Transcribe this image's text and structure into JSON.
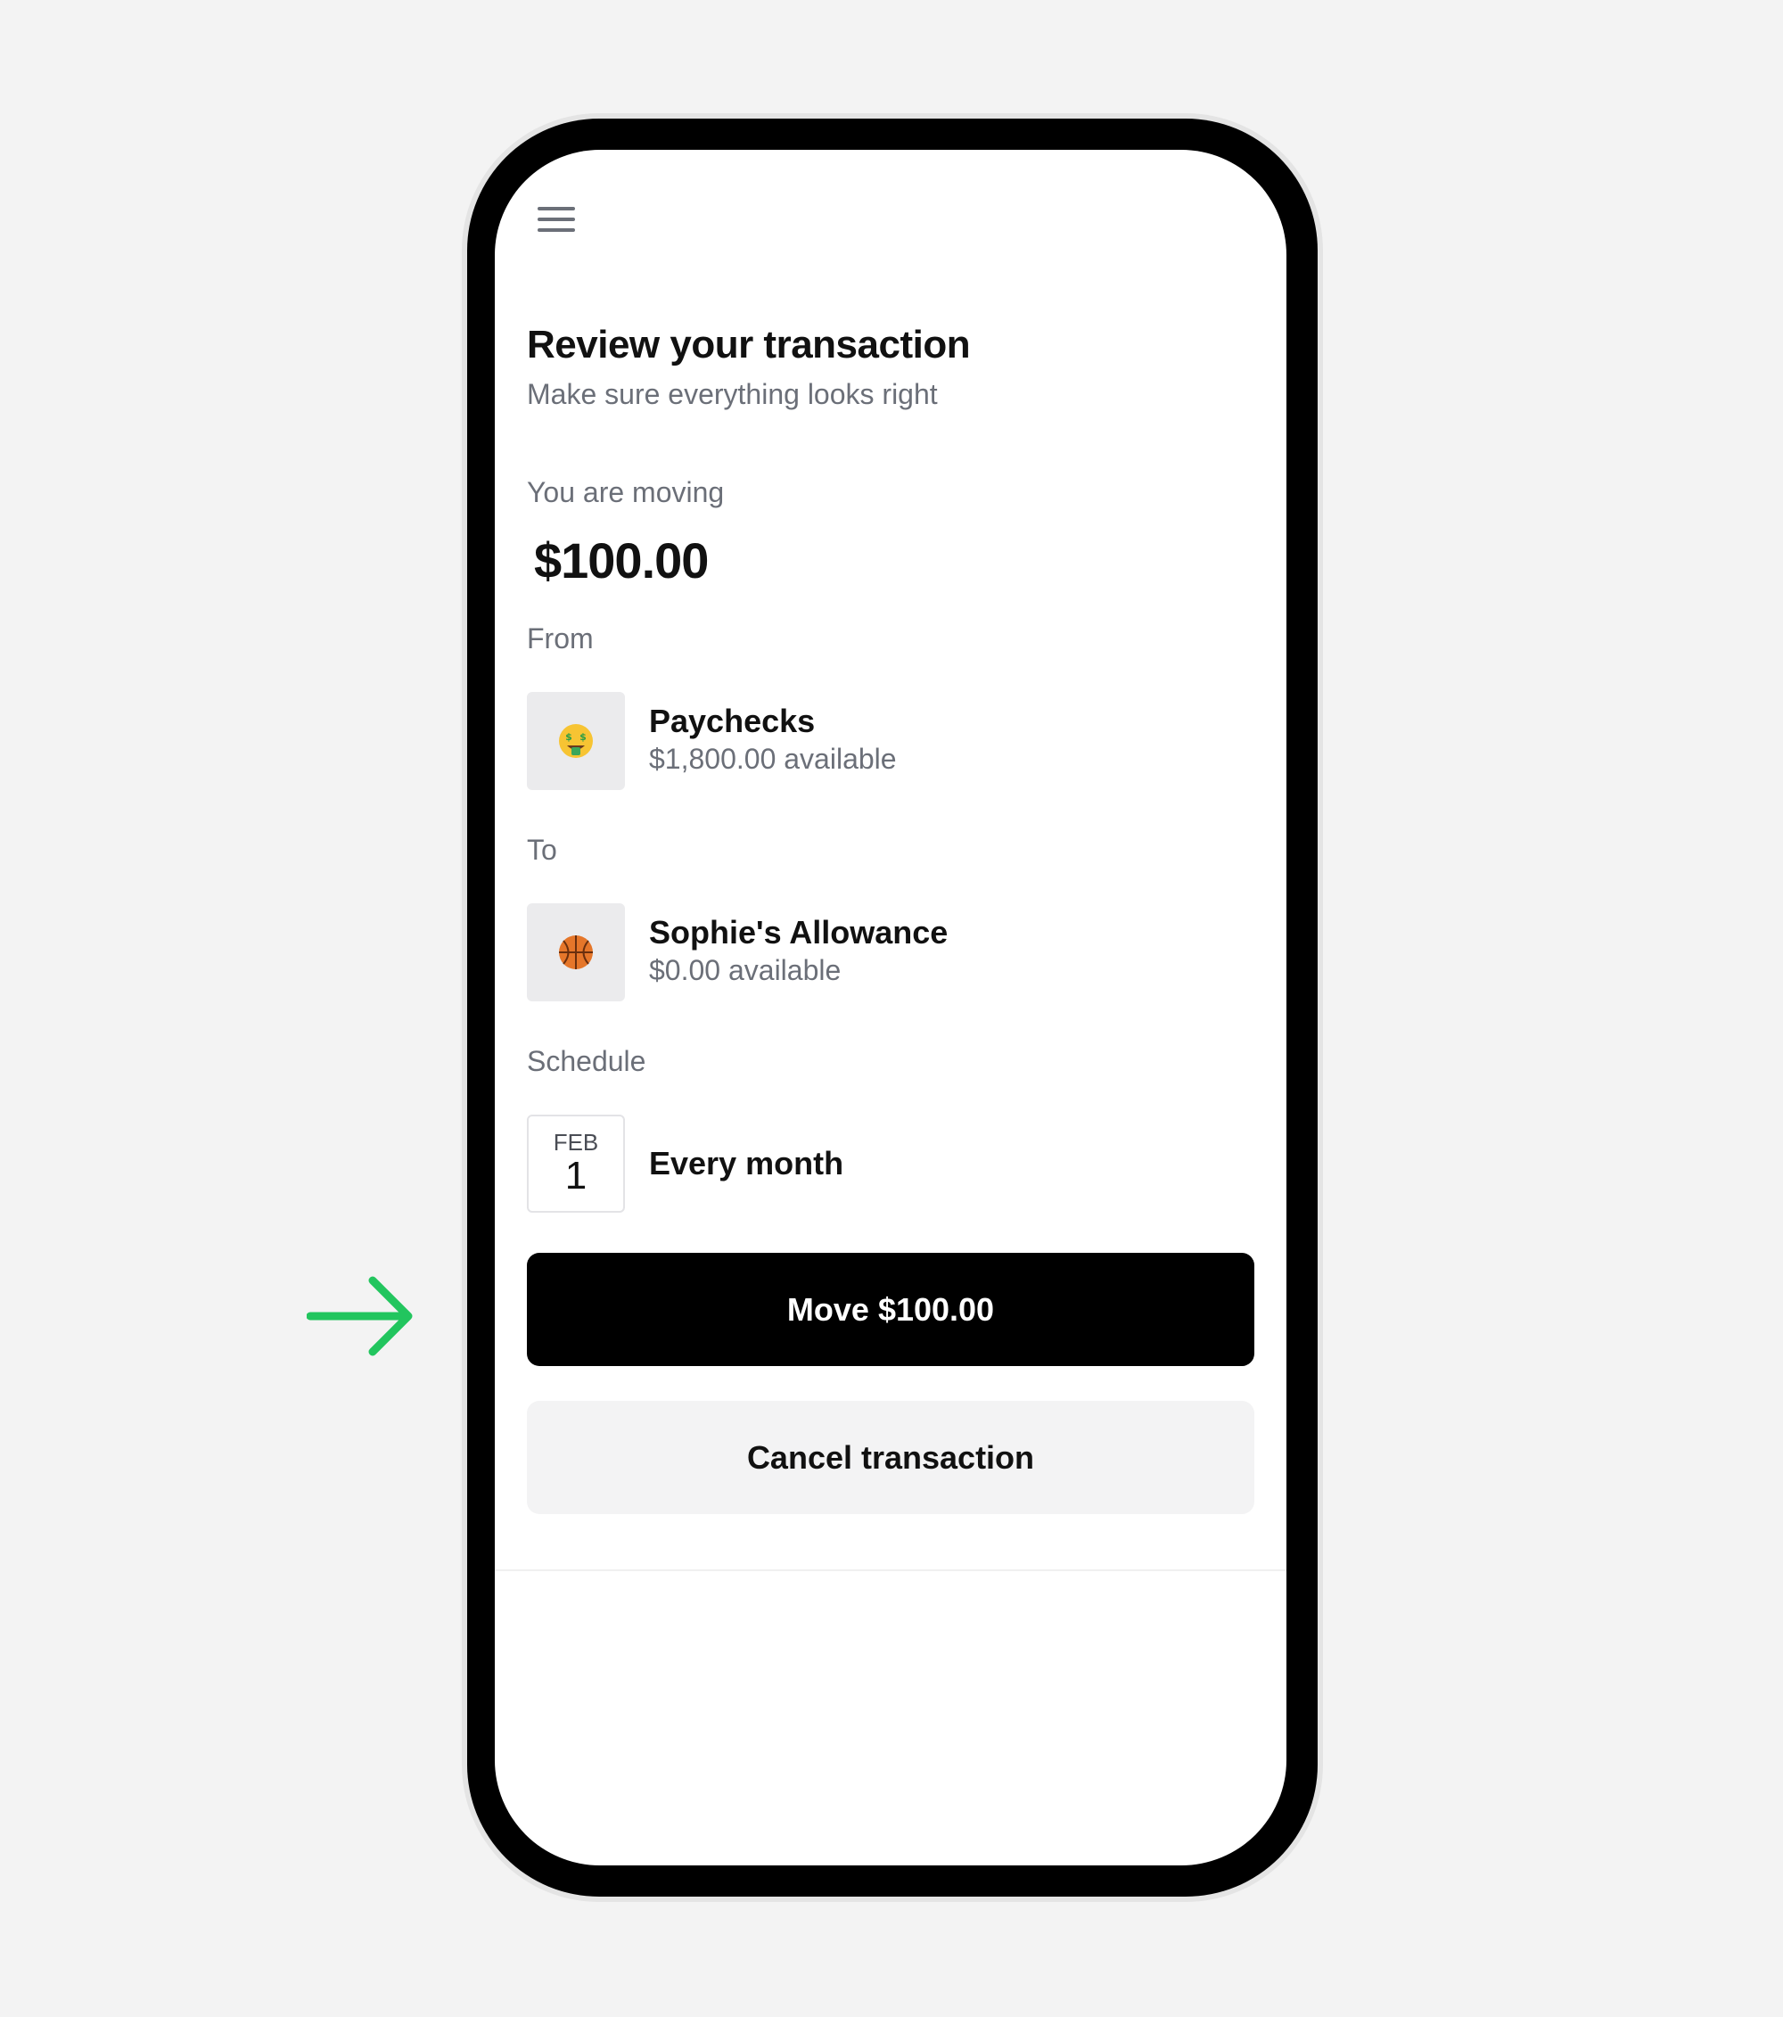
{
  "header": {
    "title": "Review your transaction",
    "subtitle": "Make sure everything looks right"
  },
  "transfer": {
    "moving_label": "You are moving",
    "amount": "$100.00"
  },
  "from": {
    "label": "From",
    "emoji": "🤑",
    "name": "Paychecks",
    "balance": "$1,800.00 available"
  },
  "to": {
    "label": "To",
    "emoji": "🏀",
    "name": "Sophie's Allowance",
    "balance": "$0.00 available"
  },
  "schedule": {
    "label": "Schedule",
    "month": "FEB",
    "day": "1",
    "frequency": "Every month"
  },
  "actions": {
    "primary_label": "Move $100.00",
    "secondary_label": "Cancel transaction"
  },
  "icons": {
    "menu": "hamburger-menu-icon",
    "arrow": "arrow-right-icon"
  },
  "colors": {
    "primary_button": "#000000",
    "secondary_button": "#f3f3f4",
    "accent_arrow": "#22c55e",
    "muted_text": "#6b6f78"
  }
}
